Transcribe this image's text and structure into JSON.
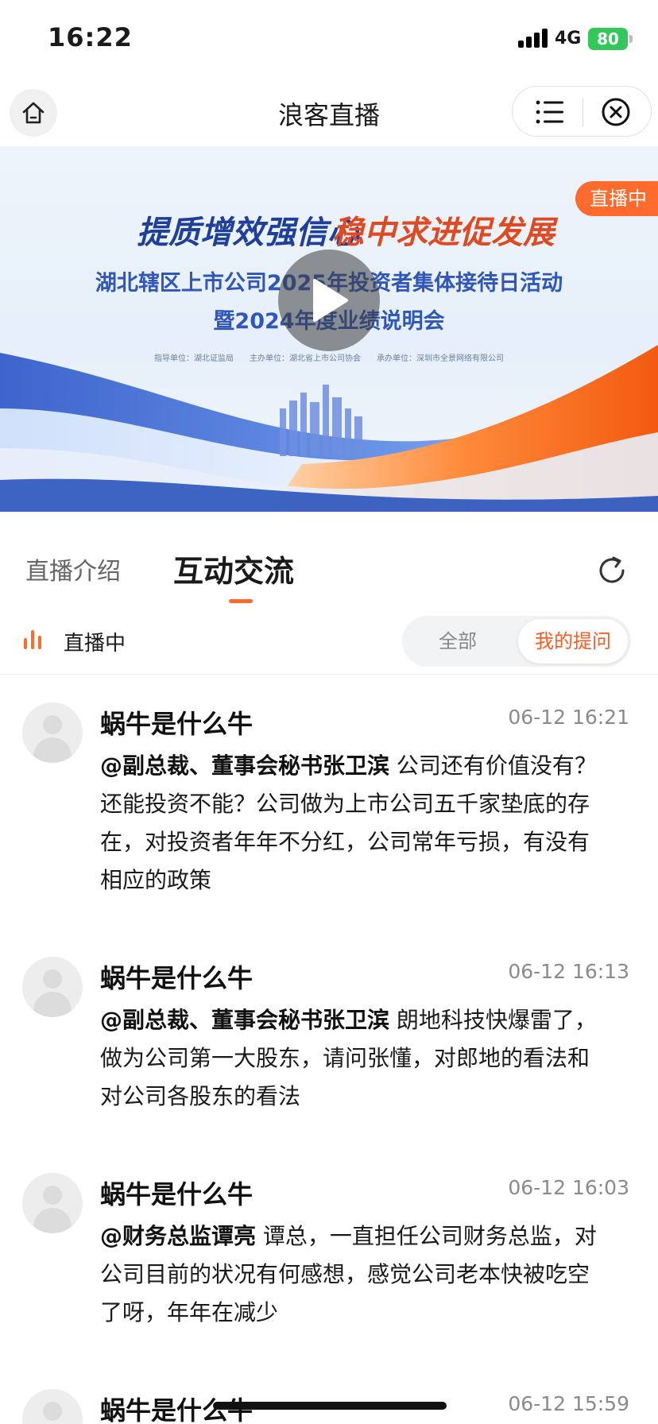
{
  "status_bar": {
    "time": "16:22",
    "network": "4G",
    "battery": "80"
  },
  "nav": {
    "title": "浪客直播"
  },
  "banner": {
    "live_badge": "直播中",
    "slogan_left": "提质增效强信心",
    "slogan_right": "稳中求进促发展",
    "title_line1": "湖北辖区上市公司2025年投资者集体接待日活动",
    "title_line2": "暨2024年度业绩说明会",
    "credits": "指导单位：湖北证监局　　主办单位：湖北省上市公司协会　　承办单位：深圳市全景网络有限公司"
  },
  "tabs": {
    "intro": "直播介绍",
    "chat": "互动交流"
  },
  "filter": {
    "live_label": "直播中",
    "all": "全部",
    "mine": "我的提问"
  },
  "messages": [
    {
      "name": "蜗牛是什么牛",
      "time": "06-12 16:21",
      "mention": "@副总裁、董事会秘书张卫滨",
      "text": " 公司还有价值没有？还能投资不能？公司做为上市公司五千家垫底的存在，对投资者年年不分红，公司常年亏损，有没有相应的政策"
    },
    {
      "name": "蜗牛是什么牛",
      "time": "06-12 16:13",
      "mention": "@副总裁、董事会秘书张卫滨",
      "text": " 朗地科技快爆雷了，做为公司第一大股东，请问张懂，对郎地的看法和对公司各股东的看法"
    },
    {
      "name": "蜗牛是什么牛",
      "time": "06-12 16:03",
      "mention": "@财务总监谭亮",
      "text": " 谭总，一直担任公司财务总监，对公司目前的状况有何感想，感觉公司老本快被吃空了呀，年年在减少"
    },
    {
      "name": "蜗牛是什么牛",
      "time": "06-12 15:59",
      "mention": "",
      "text": ""
    }
  ],
  "colors": {
    "accent": "#ff6a2d",
    "segment_active": "#ff5a1f",
    "battery": "#34c759"
  }
}
